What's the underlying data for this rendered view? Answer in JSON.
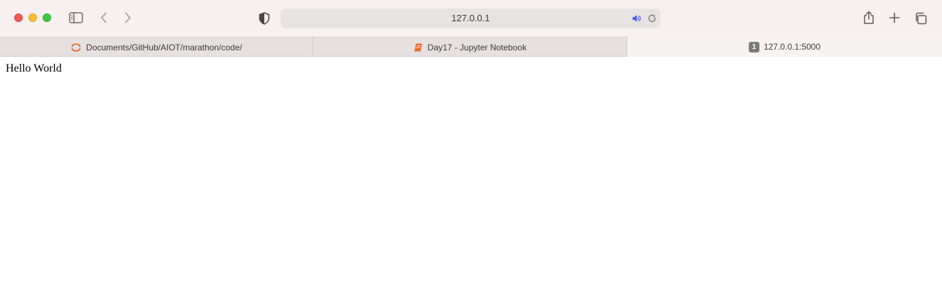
{
  "window": {
    "traffic_lights": [
      "close",
      "minimize",
      "zoom"
    ]
  },
  "toolbar": {
    "sidebar_icon": "sidebar-icon",
    "back_icon": "chevron-left-icon",
    "forward_icon": "chevron-right-icon",
    "privacy_icon": "shield-icon",
    "share_icon": "share-icon",
    "new_tab_icon": "plus-icon",
    "tab_overview_icon": "tabs-overview-icon"
  },
  "address_bar": {
    "url": "127.0.0.1",
    "audio_icon": "speaker-icon",
    "reload_icon": "reload-icon"
  },
  "tabs": [
    {
      "label": "Documents/GitHub/AIOT/marathon/code/",
      "icon": "jupyter-icon",
      "active": false
    },
    {
      "label": "Day17 - Jupyter Notebook",
      "icon": "notebook-icon",
      "active": false
    },
    {
      "label": "127.0.0.1:5000",
      "badge": "1",
      "active": true
    }
  ],
  "page": {
    "body_text": "Hello World"
  },
  "colors": {
    "toolbar_bg": "#f7f0f0",
    "tabbar_bg": "#e6e0e0",
    "active_tab_bg": "#f8f3f3",
    "close": "#ee5a52",
    "minimize": "#f5be2f",
    "zoom": "#3ec93f",
    "audio_accent": "#4a5ff0",
    "jupyter_orange": "#e46e2e"
  }
}
